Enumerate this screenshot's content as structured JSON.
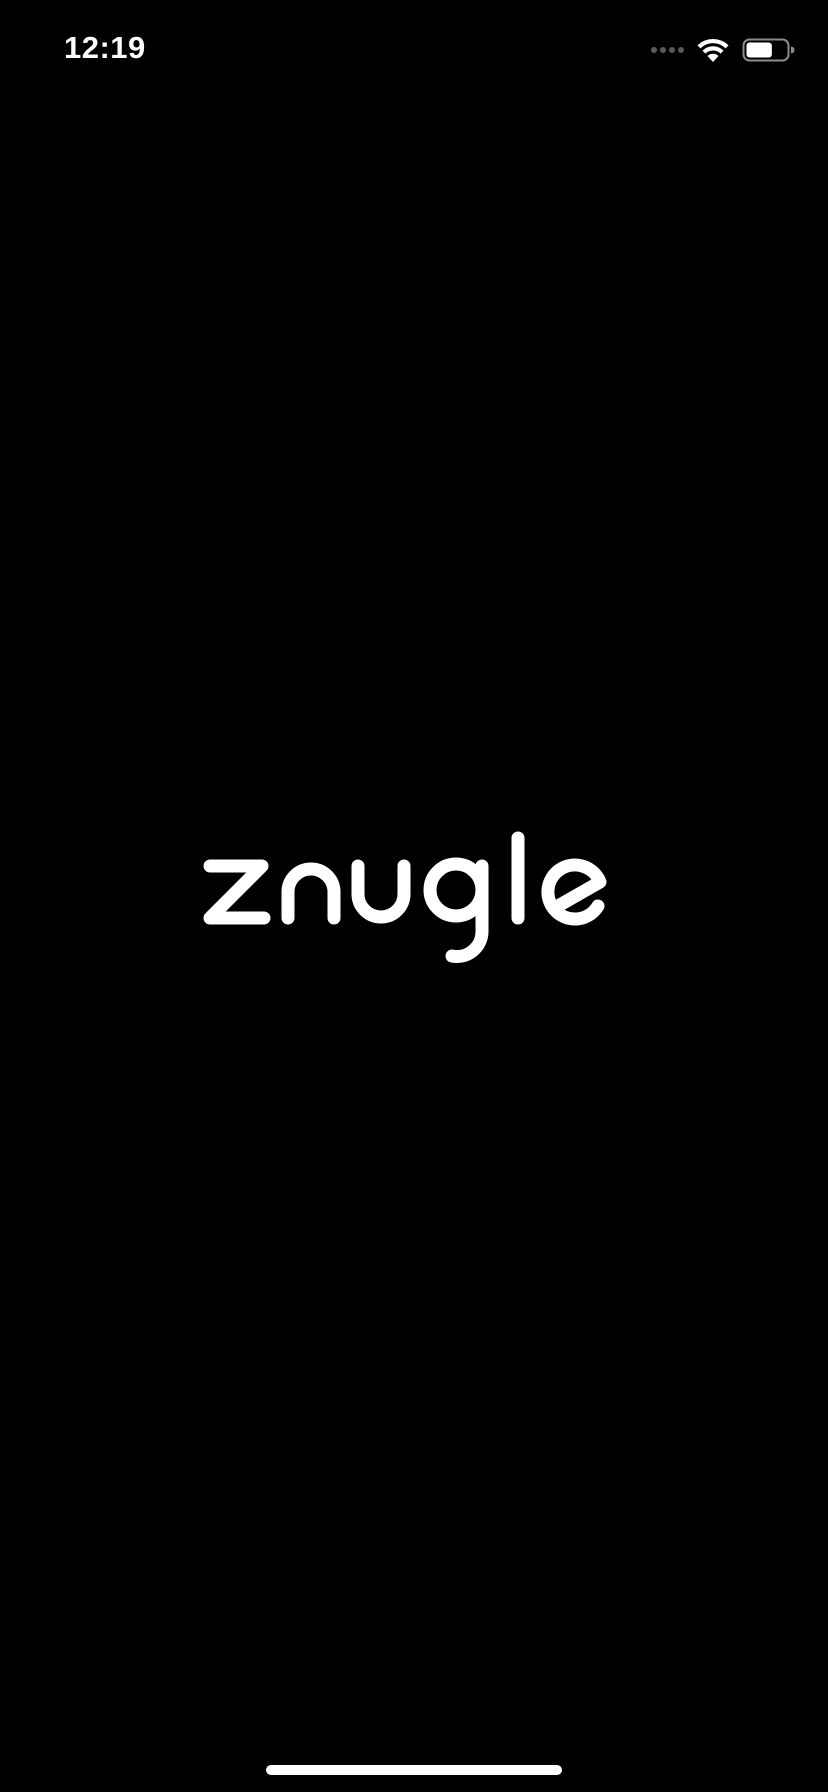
{
  "status_bar": {
    "time": "12:19",
    "signal_icon": "cellular-signal-icon",
    "wifi_icon": "wifi-icon",
    "battery_icon": "battery-icon",
    "battery_level": 0.65
  },
  "splash": {
    "logo_text": "znugle",
    "logo_color": "#ffffff",
    "background_color": "#000000"
  },
  "home_indicator": {
    "color": "#ffffff"
  }
}
